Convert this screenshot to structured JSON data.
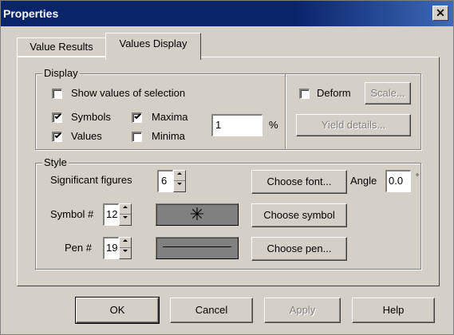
{
  "window": {
    "title": "Properties",
    "close_symbol": "✕"
  },
  "tabs": [
    {
      "label": "Value Results",
      "active": false
    },
    {
      "label": "Values Display",
      "active": true
    }
  ],
  "display_group": {
    "label": "Display",
    "show_values_of_selection": {
      "label": "Show values of selection",
      "checked": false
    },
    "symbols": {
      "label": "Symbols",
      "checked": true
    },
    "maxima": {
      "label": "Maxima",
      "checked": true
    },
    "values": {
      "label": "Values",
      "checked": true
    },
    "minima": {
      "label": "Minima",
      "checked": false
    },
    "percent_value": "1",
    "percent_unit": "%",
    "deform": {
      "label": "Deform",
      "checked": false
    },
    "scale_button": "Scale...",
    "yield_details_button": "Yield details..."
  },
  "style_group": {
    "label": "Style",
    "significant_figures_label": "Significant figures",
    "significant_figures_value": "6",
    "choose_font_button": "Choose font...",
    "angle_label": "Angle",
    "angle_value": "0.0",
    "angle_unit": "°",
    "symbol_label": "Symbol #",
    "symbol_value": "12",
    "symbol_preview_glyph": "✳",
    "choose_symbol_button": "Choose symbol",
    "pen_label": "Pen #",
    "pen_value": "19",
    "choose_pen_button": "Choose pen..."
  },
  "footer": {
    "ok": "OK",
    "cancel": "Cancel",
    "apply": "Apply",
    "help": "Help"
  },
  "icons": {
    "checkmark": "checkmark-icon",
    "spinner_up": "up-arrow-icon",
    "spinner_down": "down-arrow-icon"
  },
  "colors": {
    "titlebar": "#0a246a",
    "face": "#d4d0c8",
    "shadow": "#808080",
    "disabled_text": "#808080"
  }
}
